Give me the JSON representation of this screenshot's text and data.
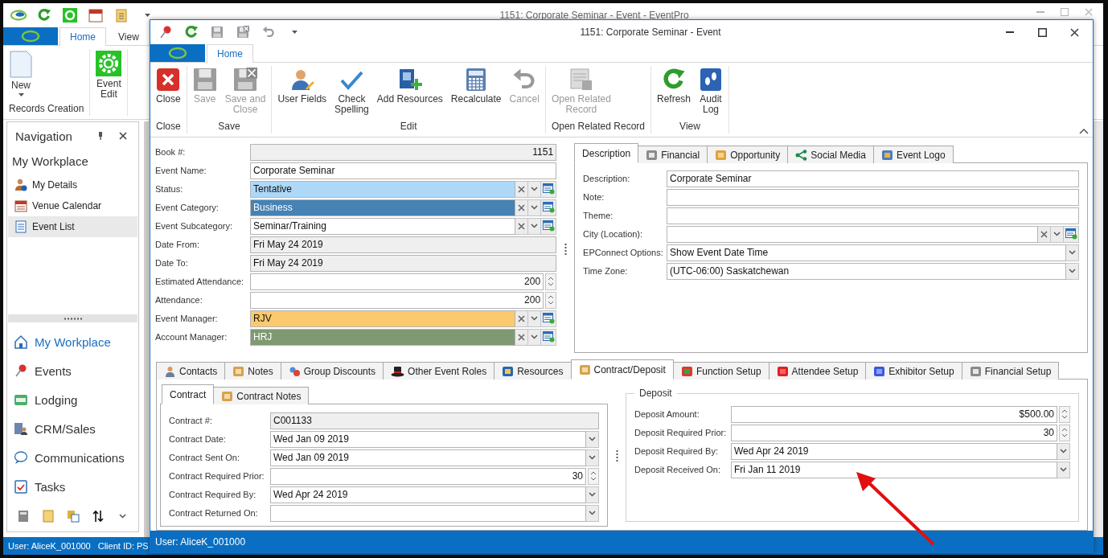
{
  "app": {
    "title": "1151: Corporate Seminar - Event - EventPro",
    "ribbon_tabs": [
      {
        "label": "Home",
        "selected": true
      },
      {
        "label": "View",
        "selected": false
      }
    ],
    "ribbon_groups": [
      {
        "label": "Records Creation",
        "buttons": [
          {
            "label": "New",
            "kind": "split"
          }
        ]
      },
      {
        "buttons": [
          {
            "label": "Event\nEdit",
            "kind": "large"
          }
        ]
      }
    ],
    "navigation": {
      "title": "Navigation",
      "section": "My Workplace",
      "items": [
        {
          "label": "My Details",
          "selected": false
        },
        {
          "label": "Venue Calendar",
          "selected": false
        },
        {
          "label": "Event List",
          "selected": true
        }
      ],
      "modules": [
        {
          "label": "My Workplace",
          "selected": true
        },
        {
          "label": "Events",
          "selected": false
        },
        {
          "label": "Lodging",
          "selected": false
        },
        {
          "label": "CRM/Sales",
          "selected": false
        },
        {
          "label": "Communications",
          "selected": false
        },
        {
          "label": "Tasks",
          "selected": false
        }
      ]
    },
    "status_bar": [
      "User: AliceK_001000",
      "Client ID: PS"
    ]
  },
  "event_window": {
    "title": "1151: Corporate Seminar - Event",
    "ribbon_tabs": [
      {
        "label": "Home",
        "selected": true
      }
    ],
    "ribbon_groups": [
      {
        "label": "Close",
        "buttons": [
          {
            "label": "Close",
            "disabled": false
          }
        ]
      },
      {
        "label": "Save",
        "buttons": [
          {
            "label": "Save",
            "disabled": true
          },
          {
            "label": "Save and\nClose",
            "disabled": true
          }
        ]
      },
      {
        "label": "Edit",
        "buttons": [
          {
            "label": "User Fields",
            "disabled": false
          },
          {
            "label": "Check\nSpelling",
            "disabled": false
          },
          {
            "label": "Add Resources",
            "disabled": false
          },
          {
            "label": "Recalculate",
            "disabled": false
          },
          {
            "label": "Cancel",
            "disabled": true
          }
        ]
      },
      {
        "label": "Open Related Record",
        "buttons": [
          {
            "label": "Open Related\nRecord",
            "disabled": true
          }
        ]
      },
      {
        "label": "View",
        "buttons": [
          {
            "label": "Refresh",
            "disabled": false
          },
          {
            "label": "Audit\nLog",
            "disabled": false
          }
        ]
      }
    ],
    "fields": [
      {
        "label": "Book #:",
        "value": "1151",
        "kind": "readonly_number"
      },
      {
        "label": "Event Name:",
        "value": "Corporate Seminar",
        "kind": "text"
      },
      {
        "label": "Status:",
        "value": "Tentative",
        "kind": "lookup",
        "color": "#add8f8"
      },
      {
        "label": "Event Category:",
        "value": "Business",
        "kind": "lookup",
        "color": "#4682b4"
      },
      {
        "label": "Event Subcategory:",
        "value": "Seminar/Training",
        "kind": "lookup",
        "color": "#ffffff"
      },
      {
        "label": "Date From:",
        "value": "Fri May 24 2019",
        "kind": "readonly"
      },
      {
        "label": "Date To:",
        "value": "Fri May 24 2019",
        "kind": "readonly"
      },
      {
        "label": "Estimated Attendance:",
        "value": "200",
        "kind": "spin"
      },
      {
        "label": "Attendance:",
        "value": "200",
        "kind": "spin"
      },
      {
        "label": "Event Manager:",
        "value": "RJV",
        "kind": "lookup",
        "color": "#fbc96e"
      },
      {
        "label": "Account Manager:",
        "value": "HRJ",
        "kind": "lookup",
        "color": "#7f9a72"
      }
    ],
    "detail_tabs": [
      {
        "label": "Description",
        "selected": true
      },
      {
        "label": "Financial",
        "selected": false
      },
      {
        "label": "Opportunity",
        "selected": false
      },
      {
        "label": "Social Media",
        "selected": false
      },
      {
        "label": "Event Logo",
        "selected": false
      }
    ],
    "description_fields": [
      {
        "label": "Description:",
        "value": "Corporate Seminar",
        "kind": "text"
      },
      {
        "label": "Note:",
        "kind": "text"
      },
      {
        "label": "Theme:",
        "kind": "text"
      },
      {
        "label": "City (Location):",
        "kind": "lookup",
        "color": "#ffffff"
      },
      {
        "label": "EPConnect Options:",
        "value": "Show Event Date Time",
        "kind": "dropdown"
      },
      {
        "label": "Time Zone:",
        "value": "(UTC-06:00) Saskatchewan",
        "kind": "dropdown"
      }
    ],
    "section_tabs": [
      {
        "label": "Contacts",
        "selected": false
      },
      {
        "label": "Notes",
        "selected": false
      },
      {
        "label": "Group Discounts",
        "selected": false
      },
      {
        "label": "Other Event Roles",
        "selected": false
      },
      {
        "label": "Resources",
        "selected": false
      },
      {
        "label": "Contract/Deposit",
        "selected": true
      },
      {
        "label": "Function Setup",
        "selected": false
      },
      {
        "label": "Attendee Setup",
        "selected": false
      },
      {
        "label": "Exhibitor Setup",
        "selected": false
      },
      {
        "label": "Financial Setup",
        "selected": false
      }
    ],
    "contract_tabs": [
      {
        "label": "Contract",
        "selected": true
      },
      {
        "label": "Contract Notes",
        "selected": false
      }
    ],
    "contract_fields": [
      {
        "label": "Contract #:",
        "value": "C001133",
        "kind": "readonly"
      },
      {
        "label": "Contract Date:",
        "value": "Wed Jan 09 2019",
        "kind": "dropdown"
      },
      {
        "label": "Contract Sent On:",
        "value": "Wed Jan 09 2019",
        "kind": "dropdown"
      },
      {
        "label": "Contract Required Prior:",
        "value": "30",
        "kind": "spin"
      },
      {
        "label": "Contract Required By:",
        "value": "Wed Apr 24 2019",
        "kind": "dropdown"
      },
      {
        "label": "Contract Returned On:",
        "kind": "dropdown"
      }
    ],
    "deposit": {
      "title": "Deposit",
      "fields": [
        {
          "label": "Deposit Amount:",
          "value": "$500.00",
          "kind": "spin"
        },
        {
          "label": "Deposit Required Prior:",
          "value": "30",
          "kind": "spin"
        },
        {
          "label": "Deposit Required By:",
          "value": "Wed Apr 24 2019",
          "kind": "dropdown"
        },
        {
          "label": "Deposit Received On:",
          "value": "Fri Jan 11 2019",
          "kind": "dropdown"
        }
      ]
    },
    "status_bar": "User: AliceK_001000"
  }
}
